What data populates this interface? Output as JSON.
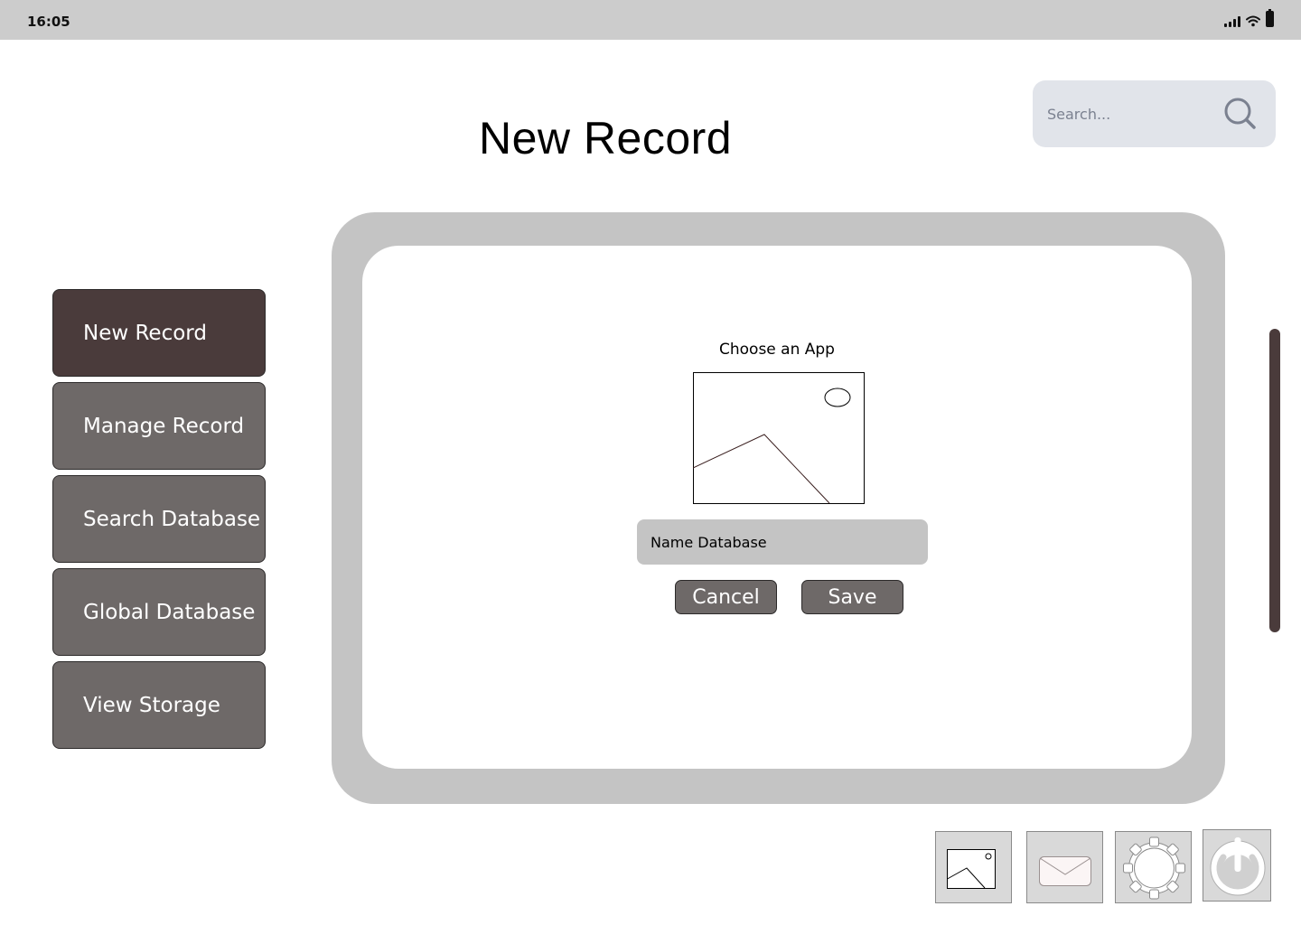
{
  "status_bar": {
    "time": "16:05",
    "icons": [
      "cellular-signal-icon",
      "wifi-icon",
      "battery-icon"
    ]
  },
  "header": {
    "title": "New Record",
    "search": {
      "placeholder": "Search...",
      "icon": "search-icon"
    }
  },
  "sidebar": {
    "items": [
      {
        "label": "New Record",
        "active": true
      },
      {
        "label": "Manage Record",
        "active": false
      },
      {
        "label": "Search Database",
        "active": false
      },
      {
        "label": "Global Database",
        "active": false
      },
      {
        "label": "View Storage",
        "active": false
      }
    ]
  },
  "dialog": {
    "choose_label": "Choose an App",
    "image_icon": "image-placeholder-icon",
    "name_field": {
      "placeholder": "Name Database",
      "value": ""
    },
    "cancel_label": "Cancel",
    "save_label": "Save"
  },
  "dock": {
    "items": [
      "gallery-icon",
      "mail-icon",
      "settings-gear-icon",
      "power-icon"
    ]
  },
  "colors": {
    "status_bar": "#cccccc",
    "nav_active": "#4a3b3b",
    "nav_default": "#6e6968",
    "frame": "#c4c4c4",
    "search_bg": "#e1e4ea",
    "scrollbar": "#4a3b3b"
  }
}
